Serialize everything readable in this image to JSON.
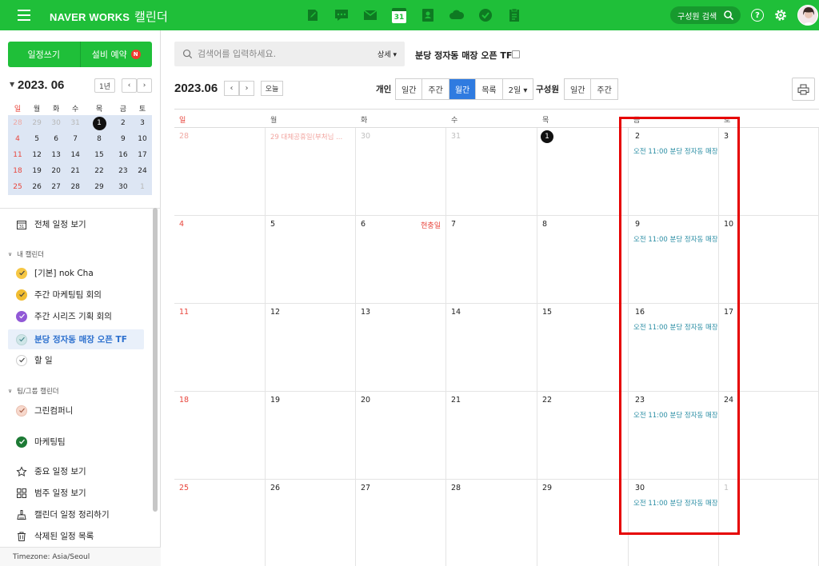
{
  "topbar": {
    "brand": "NAVER WORKS",
    "app_name": "캘린더",
    "calendar_app_day": "31",
    "member_search": "구성원 검색",
    "help": "?"
  },
  "sidebar": {
    "write_button": "일정쓰기",
    "reserve_button": "설비 예약",
    "reserve_badge": "N",
    "mini_month": "2023. 06",
    "one_year_button": "1년",
    "weekdays": [
      "일",
      "월",
      "화",
      "수",
      "목",
      "금",
      "토"
    ],
    "mini_weeks": [
      [
        "28",
        "29",
        "30",
        "31",
        "1",
        "2",
        "3"
      ],
      [
        "4",
        "5",
        "6",
        "7",
        "8",
        "9",
        "10"
      ],
      [
        "11",
        "12",
        "13",
        "14",
        "15",
        "16",
        "17"
      ],
      [
        "18",
        "19",
        "20",
        "21",
        "22",
        "23",
        "24"
      ],
      [
        "25",
        "26",
        "27",
        "28",
        "29",
        "30",
        "1"
      ]
    ],
    "view_all": "전체 일정 보기",
    "my_calendars_label": "내 캘린더",
    "my_calendars": [
      {
        "label": "[기본] nok Cha",
        "color": "#f6c744",
        "active": false
      },
      {
        "label": "주간 마케팅팀 회의",
        "color": "#f1bd32",
        "active": false
      },
      {
        "label": "주간 시리즈 기획 회의",
        "color": "#9159d6",
        "active": false
      },
      {
        "label": "분당 정자동 매장 오픈 TF",
        "color": "#cfe6e8",
        "active": true
      },
      {
        "label": "할 일",
        "color": "#ffffff",
        "active": false
      }
    ],
    "team_calendars_label": "팀/그룹 캘린더",
    "team_calendars": [
      {
        "label": "그린컴퍼니",
        "color": "#f7d8cc"
      },
      {
        "label": "마케팅팀",
        "color": "#1d7a35"
      }
    ],
    "extras": [
      {
        "label": "중요 일정 보기",
        "icon": "star-icon"
      },
      {
        "label": "범주 일정 보기",
        "icon": "grid-icon"
      },
      {
        "label": "캘린더 일정 정리하기",
        "icon": "broom-icon"
      },
      {
        "label": "삭제된 일정 목록",
        "icon": "trash-icon"
      }
    ],
    "timezone": "Timezone: Asia/Seoul"
  },
  "main": {
    "search_placeholder": "검색어를 입력하세요.",
    "search_detail": "상세 ▾",
    "calendar_name": "분당 정자동 매장 오픈 TF",
    "month_title": "2023.06",
    "today_button": "오늘",
    "personal_label": "개인",
    "personal_views": [
      "일간",
      "주간",
      "월간",
      "목록",
      "2일 ▾"
    ],
    "personal_selected": "월간",
    "member_label": "구성원",
    "member_views": [
      "일간",
      "주간"
    ],
    "dow_headers": [
      "일",
      "월",
      "화",
      "수",
      "목",
      "금",
      "토"
    ],
    "weeks": [
      [
        "28",
        "29",
        "30",
        "31",
        "1",
        "2",
        "3"
      ],
      [
        "4",
        "5",
        "6",
        "7",
        "8",
        "9",
        "10"
      ],
      [
        "11",
        "12",
        "13",
        "14",
        "15",
        "16",
        "17"
      ],
      [
        "18",
        "19",
        "20",
        "21",
        "22",
        "23",
        "24"
      ],
      [
        "25",
        "26",
        "27",
        "28",
        "29",
        "30",
        "1"
      ]
    ],
    "past_event": "29 대체공휴일(부처님 ...",
    "holiday": "현충일",
    "friday_event": "오전 11:00 분당 정자동 매장",
    "today_date": "1"
  },
  "colors": {
    "brand_green": "#1fbf39",
    "selected_blue": "#2f7be0",
    "event_teal": "#2d8fa5",
    "sunday_red": "#e8453c",
    "highlight_red": "#e60000"
  }
}
